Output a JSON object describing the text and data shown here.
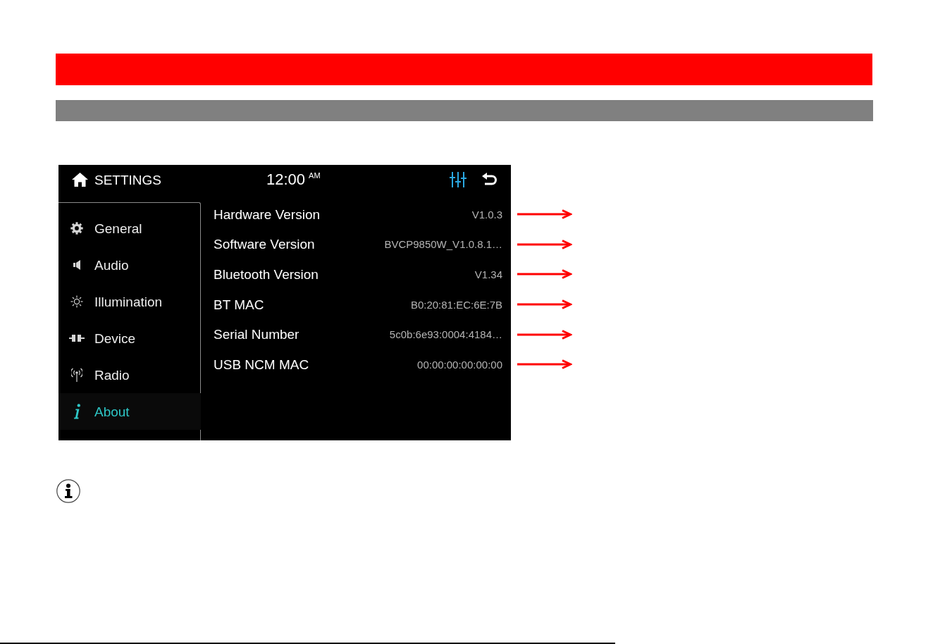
{
  "device_screen": {
    "title": "SETTINGS",
    "clock": {
      "time": "12:00",
      "period": "AM"
    },
    "sidebar": {
      "items": [
        {
          "label": "General",
          "selected": false
        },
        {
          "label": "Audio",
          "selected": false
        },
        {
          "label": "Illumination",
          "selected": false
        },
        {
          "label": "Device",
          "selected": false
        },
        {
          "label": "Radio",
          "selected": false
        },
        {
          "label": "About",
          "selected": true
        }
      ]
    },
    "info_rows": [
      {
        "label": "Hardware Version",
        "value": "V1.0.3"
      },
      {
        "label": "Software Version",
        "value": "BVCP9850W_V1.0.8.1…"
      },
      {
        "label": "Bluetooth Version",
        "value": "V1.34"
      },
      {
        "label": "BT MAC",
        "value": "B0:20:81:EC:6E:7B"
      },
      {
        "label": "Serial Number",
        "value": "5c0b:6e93:0004:4184…"
      },
      {
        "label": "USB NCM MAC",
        "value": "00:00:00:00:00:00"
      }
    ]
  }
}
